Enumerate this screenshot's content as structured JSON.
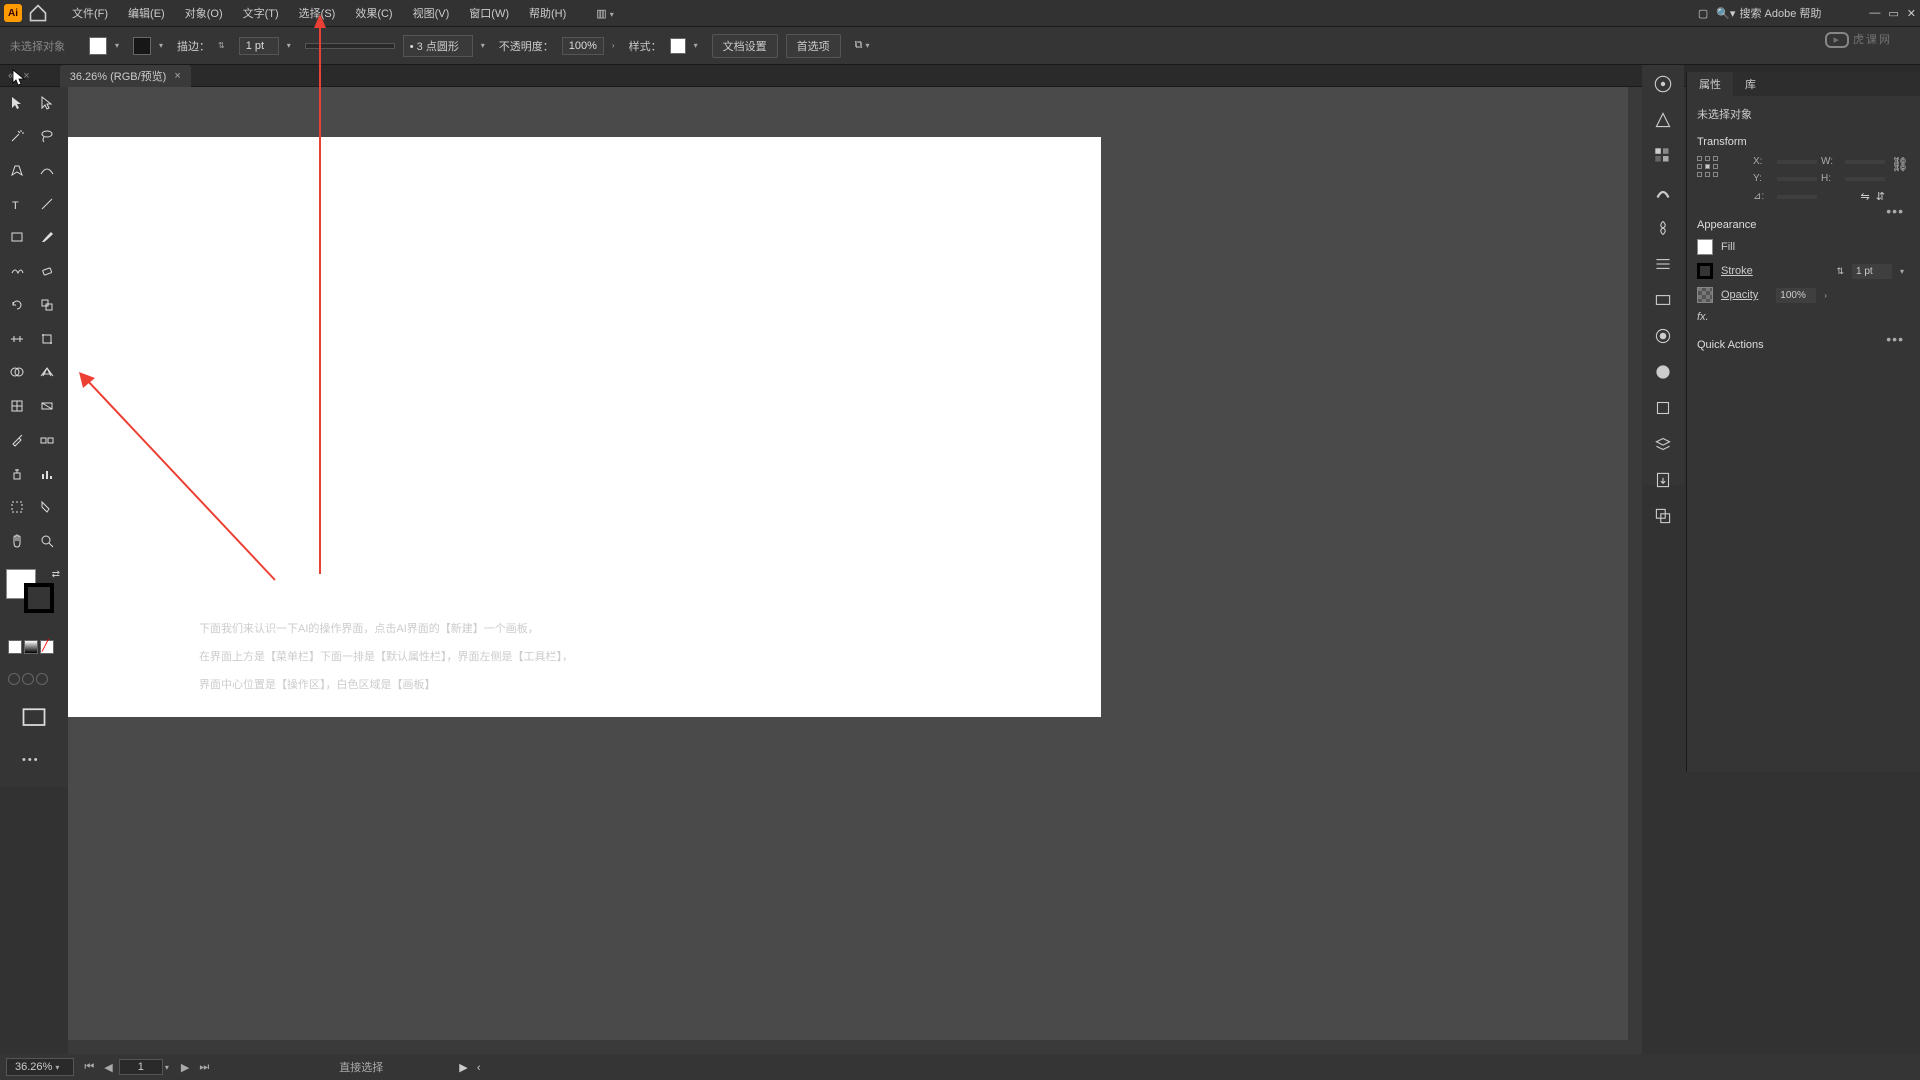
{
  "menu": {
    "file": "文件(F)",
    "edit": "编辑(E)",
    "object": "对象(O)",
    "type": "文字(T)",
    "select": "选择(S)",
    "effect": "效果(C)",
    "view": "视图(V)",
    "window": "窗口(W)",
    "help": "帮助(H)"
  },
  "search_placeholder": "搜索 Adobe 帮助",
  "controlbar": {
    "no_selection": "未选择对象",
    "stroke_label": "描边：",
    "stroke_value": "1 pt",
    "shape_label": "3 点圆形",
    "opacity_label": "不透明度：",
    "opacity_value": "100%",
    "style_label": "样式：",
    "doc_setup": "文档设置",
    "preferences": "首选项"
  },
  "tab": {
    "title": "36.26% (RGB/预览)",
    "close": "×"
  },
  "panel": {
    "tabs": {
      "properties": "属性",
      "library": "库"
    },
    "no_selection": "未选择对象",
    "transform": {
      "title": "Transform",
      "x": "X:",
      "y": "Y:",
      "w": "W:",
      "h": "H:",
      "angle": "⊿:"
    },
    "appearance": {
      "title": "Appearance",
      "fill": "Fill",
      "stroke": "Stroke",
      "stroke_val": "1 pt",
      "opacity": "Opacity",
      "opacity_val": "100%",
      "fx": "fx."
    },
    "quick_actions": "Quick Actions"
  },
  "statusbar": {
    "zoom": "36.26%",
    "page": "1",
    "tool": "直接选择"
  },
  "tutorial": {
    "line1": "下面我们来认识一下AI的操作界面，点击AI界面的【新建】一个画板，",
    "line2": "在界面上方是【菜单栏】下面一排是【默认属性栏】，界面左侧是【工具栏】，",
    "line3": "界面中心位置是【操作区】，白色区域是【画板】"
  },
  "watermark": "虎课网",
  "stepper_up": "▲",
  "stepper_dn": "▼"
}
